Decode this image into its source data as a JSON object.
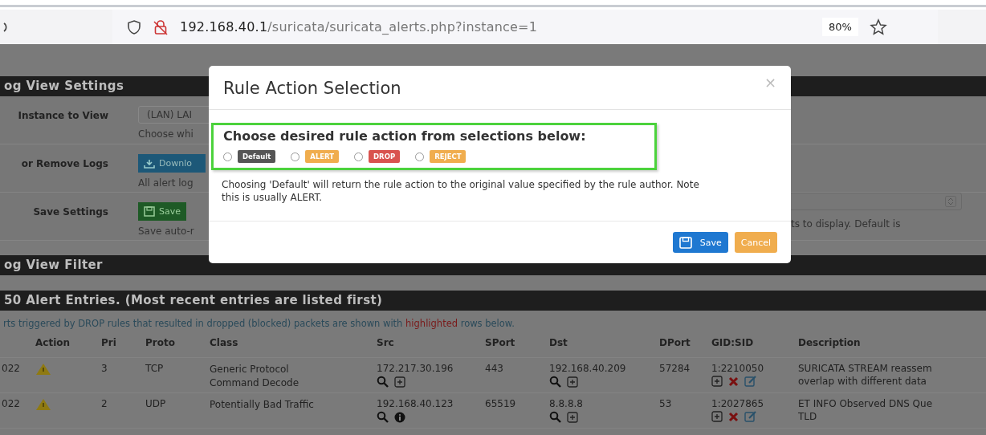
{
  "browser": {
    "url_host": "192.168.40.1",
    "url_path": "/suricata/suricata_alerts.php?instance=1",
    "zoom": "80%"
  },
  "settings_panel": {
    "title": "og View Settings",
    "rows": [
      {
        "label": "Instance to View",
        "kind": "select",
        "control": "(LAN) LAI",
        "help": "Choose whi"
      },
      {
        "label": "or Remove Logs",
        "kind": "download",
        "control": "Downlo",
        "help": "All alert log"
      },
      {
        "label": "Save Settings",
        "kind": "save",
        "control": "Save",
        "help": "Save auto-r"
      }
    ],
    "side_help": "ts to display. Default is"
  },
  "filter_panel": {
    "title": "og View Filter"
  },
  "alerts_panel": {
    "title": "50 Alert Entries. (Most recent entries are listed first)",
    "notice": {
      "before": "rts triggered by DROP rules that resulted in dropped (blocked) packets are shown with ",
      "highlight": "highlighted",
      "after": " rows below."
    },
    "columns": [
      "Action",
      "Pri",
      "Proto",
      "Class",
      "Src",
      "SPort",
      "Dst",
      "DPort",
      "GID:SID",
      "Description"
    ],
    "rows": [
      {
        "column_1": "022",
        "pri": "3",
        "proto": "TCP",
        "class": "Generic Protocol Command Decode",
        "src": "172.217.30.196",
        "src_info": false,
        "sport": "443",
        "dst": "192.168.40.209",
        "dport": "57284",
        "gid_sid": "1:2210050",
        "description": [
          "SURICATA STREAM reassem",
          "overlap with different data"
        ]
      },
      {
        "column_1": "022",
        "pri": "2",
        "proto": "UDP",
        "class": "Potentially Bad Traffic",
        "src": "192.168.40.123",
        "src_info": true,
        "sport": "65519",
        "dst": "8.8.8.8",
        "dport": "53",
        "gid_sid": "1:2027865",
        "description": [
          "ET INFO Observed DNS Que",
          "TLD"
        ]
      }
    ]
  },
  "modal": {
    "title": "Rule Action Selection",
    "close": "×",
    "prompt": "Choose desired rule action from selections below:",
    "options": [
      {
        "label": "Default",
        "color": "#555555",
        "selected": false
      },
      {
        "label": "ALERT",
        "color": "#f0ad4e",
        "selected": false
      },
      {
        "label": "DROP",
        "color": "#d9534f",
        "selected": false
      },
      {
        "label": "REJECT",
        "color": "#f0ad4e",
        "selected": false
      }
    ],
    "note": "Choosing 'Default' will return the rule action to the original value specified by the rule author. Note this is usually ALERT.",
    "buttons": [
      {
        "label": "Save",
        "kind": "primary"
      },
      {
        "label": "Cancel",
        "kind": "warning"
      }
    ]
  }
}
